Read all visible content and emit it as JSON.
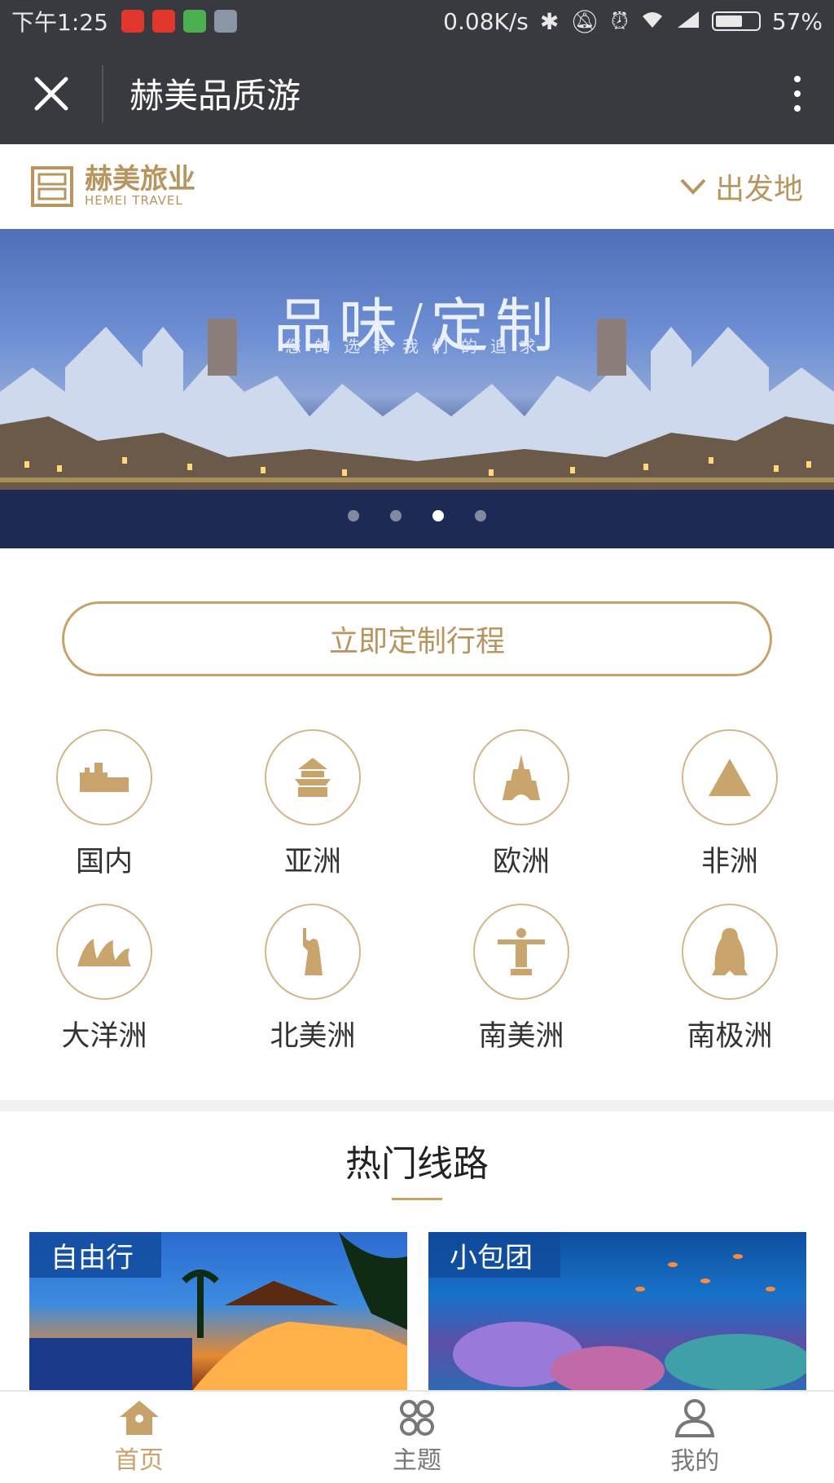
{
  "statusbar": {
    "time": "下午1:25",
    "network_speed": "0.08K/s",
    "battery_percent": "57%",
    "battery_level": 0.57,
    "icons": [
      "weibo-icon",
      "weibo-icon",
      "wechat-app-icon",
      "notes-icon",
      "bluetooth-icon",
      "mute-icon",
      "alarm-icon",
      "wifi-icon",
      "signal-icon",
      "battery-icon"
    ]
  },
  "titlebar": {
    "title": "赫美品质游",
    "close_icon": "close-icon",
    "more_icon": "more-vertical-icon"
  },
  "brand": {
    "name_zh": "赫美旅业",
    "name_en": "HEMEI TRAVEL",
    "departure_label": "出发地",
    "accent": "#c7a26a"
  },
  "banner": {
    "title": "品味/定制",
    "subtitle": "您的选择我们的追求",
    "slide_count": 4,
    "active_slide": 3
  },
  "cta": {
    "label": "立即定制行程"
  },
  "regions": [
    {
      "label": "国内",
      "icon": "great-wall-icon"
    },
    {
      "label": "亚洲",
      "icon": "temple-icon"
    },
    {
      "label": "欧洲",
      "icon": "eiffel-tower-icon"
    },
    {
      "label": "非洲",
      "icon": "pyramid-icon"
    },
    {
      "label": "大洋洲",
      "icon": "opera-house-icon"
    },
    {
      "label": "北美洲",
      "icon": "statue-of-liberty-icon"
    },
    {
      "label": "南美洲",
      "icon": "christ-redeemer-icon"
    },
    {
      "label": "南极洲",
      "icon": "penguin-icon"
    }
  ],
  "hot_routes": {
    "title": "热门线路",
    "cards": [
      {
        "tag": "自由行"
      },
      {
        "tag": "小包团"
      }
    ]
  },
  "tabbar": {
    "tabs": [
      {
        "label": "首页",
        "icon": "home-icon",
        "active": true
      },
      {
        "label": "主题",
        "icon": "theme-grid-icon",
        "active": false
      },
      {
        "label": "我的",
        "icon": "user-icon",
        "active": false
      }
    ]
  }
}
